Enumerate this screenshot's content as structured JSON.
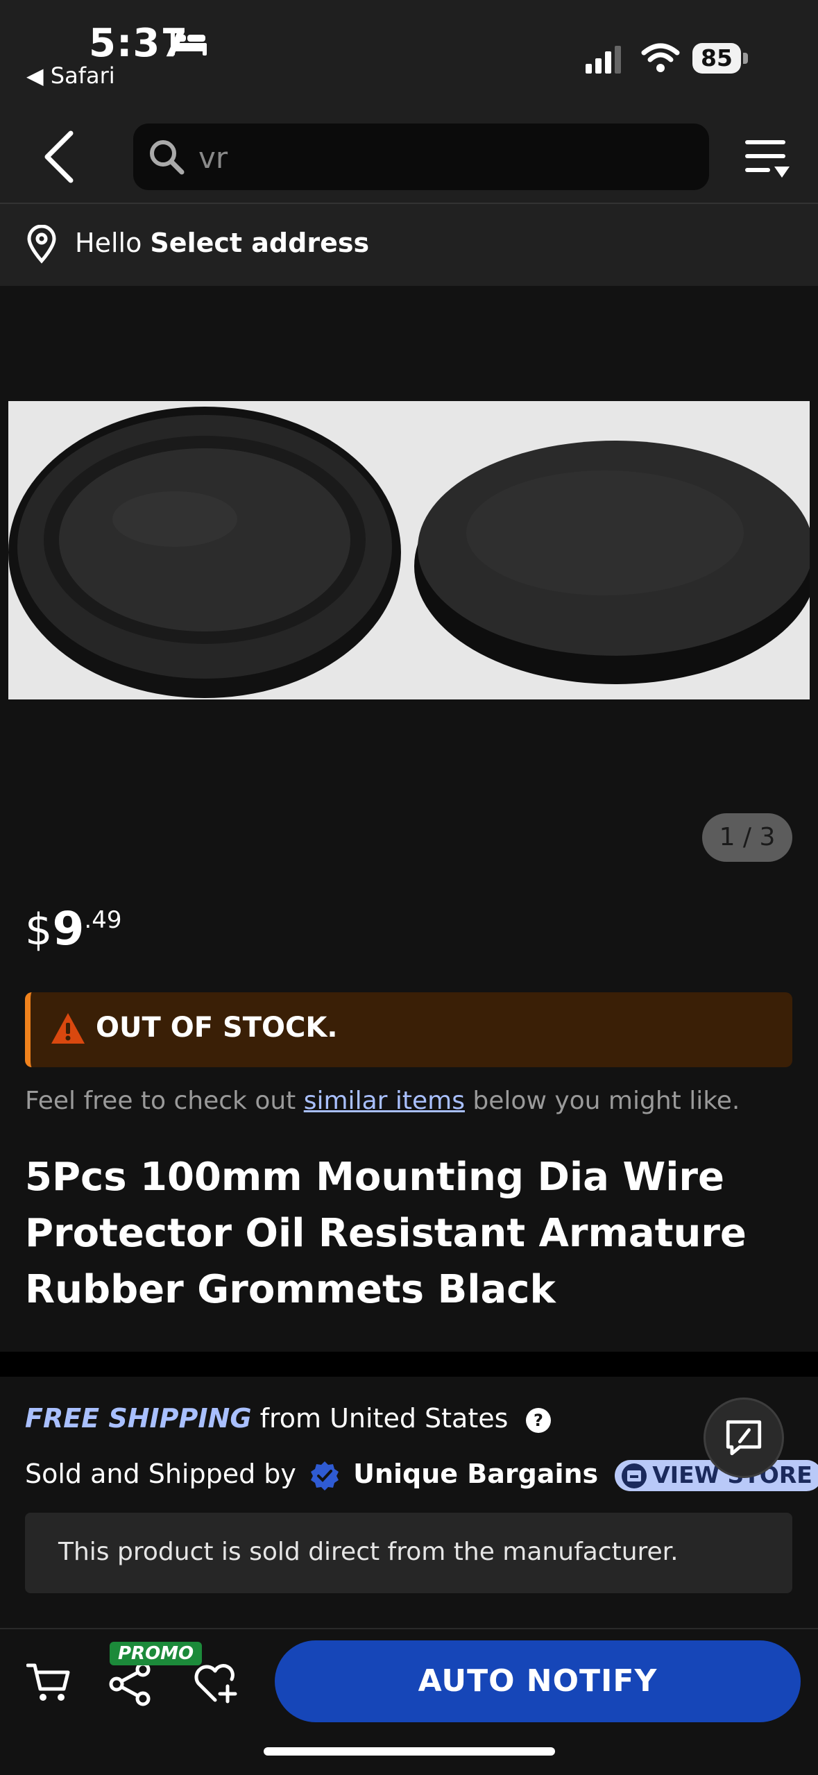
{
  "status_bar": {
    "time": "5:37",
    "back_app": "◀ Safari",
    "battery": "85"
  },
  "header": {
    "search_value": "vr"
  },
  "address": {
    "greeting": "Hello",
    "action": "Select address"
  },
  "gallery": {
    "indicator": "1 / 3"
  },
  "price": {
    "currency": "$",
    "dollars": "9",
    "cents": ".49"
  },
  "stock": {
    "status": "OUT OF STOCK."
  },
  "similar": {
    "prefix": "Feel free to check out ",
    "link": "similar items",
    "suffix": " below you might like."
  },
  "product": {
    "title": "5Pcs 100mm Mounting Dia Wire Protector Oil Resistant Armature Rubber Grommets Black"
  },
  "shipping": {
    "free_label": "FREE SHIPPING",
    "from_text": " from United States",
    "sold_by_label": "Sold and Shipped by",
    "store_name": "Unique Bargains",
    "view_store": "VIEW STORE",
    "notice": "This product is sold direct from the manufacturer."
  },
  "bottom_bar": {
    "promo": "PROMO",
    "notify_label": "AUTO NOTIFY"
  },
  "colors": {
    "accent_blue": "#1646b8",
    "warning_orange": "#f0821d",
    "link_blue": "#a9c0ff"
  }
}
